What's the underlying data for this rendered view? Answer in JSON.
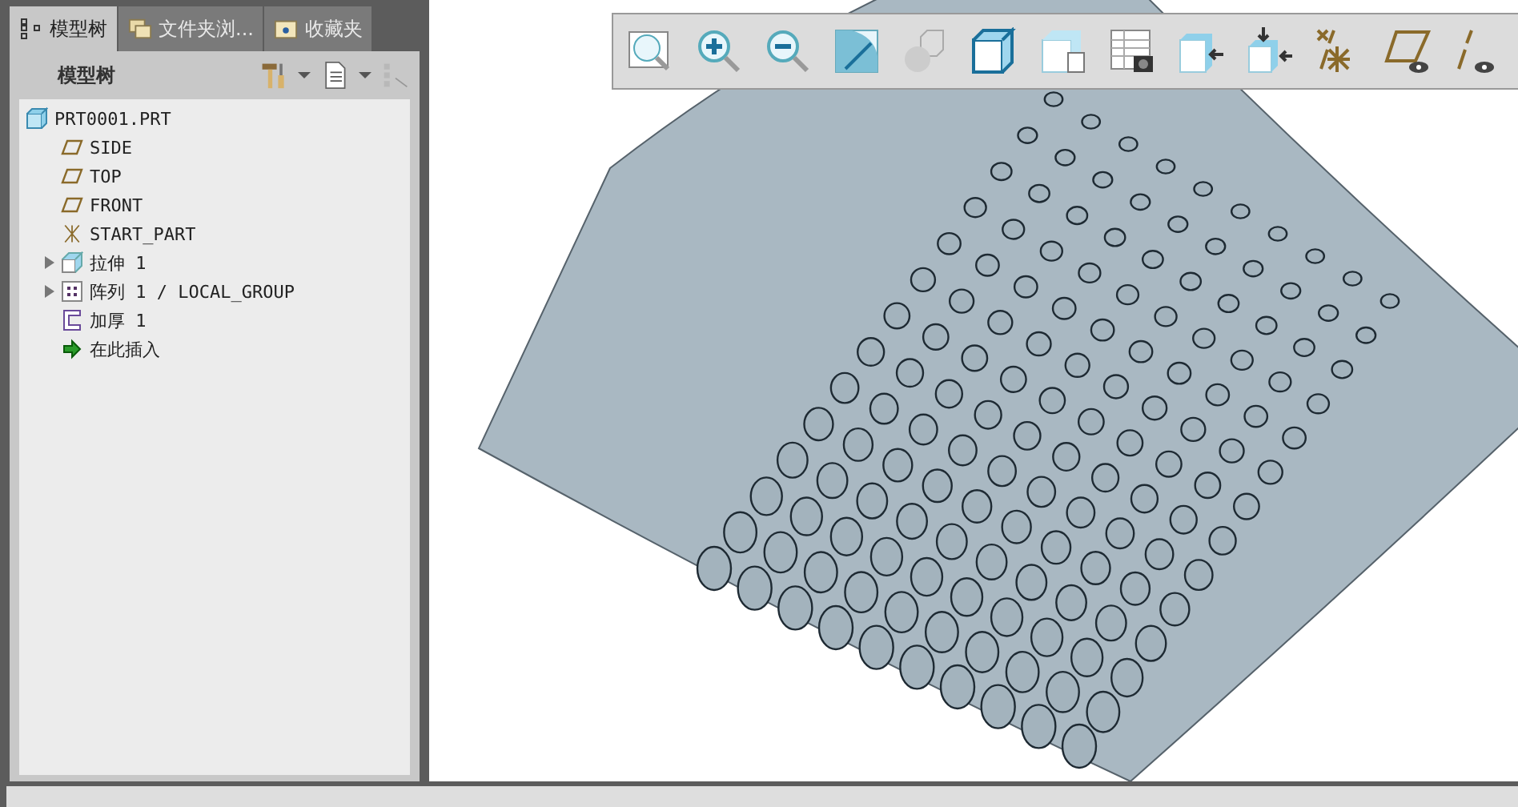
{
  "tabs": [
    {
      "label": "模型树",
      "selected": true
    },
    {
      "label": "文件夹浏...",
      "selected": false
    },
    {
      "label": "收藏夹",
      "selected": false
    }
  ],
  "panel": {
    "title": "模型树"
  },
  "tree": [
    {
      "kind": "part",
      "label": "PRT0001.PRT"
    },
    {
      "kind": "plane",
      "label": "SIDE"
    },
    {
      "kind": "plane",
      "label": "TOP"
    },
    {
      "kind": "plane",
      "label": "FRONT"
    },
    {
      "kind": "csys",
      "label": "START_PART"
    },
    {
      "kind": "extrude",
      "label": "拉伸 1",
      "expanded": false
    },
    {
      "kind": "pattern",
      "label": "阵列 1 / LOCAL_GROUP",
      "expanded": false
    },
    {
      "kind": "thicken",
      "label": "加厚 1"
    },
    {
      "kind": "insert",
      "label": "在此插入"
    }
  ]
}
